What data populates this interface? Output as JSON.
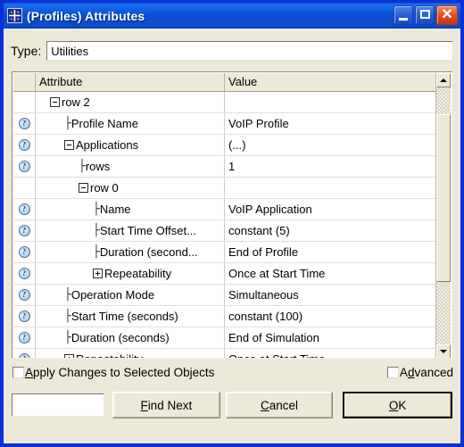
{
  "window": {
    "title": "(Profiles) Attributes",
    "icon": "sparkle-icon",
    "titlebar_color": "#0b52d4",
    "face_color": "#ece9d8",
    "buttons": {
      "minimize": "minimize-icon",
      "maximize": "maximize-icon",
      "close": "close-icon"
    }
  },
  "type_field": {
    "label": "Type:",
    "value": "Utilities",
    "placeholder": ""
  },
  "table": {
    "columns": [
      "",
      "Attribute",
      "Value"
    ],
    "rows": [
      {
        "icon": "",
        "indent": 1,
        "marker": "minus",
        "branch": "",
        "attribute": "row 2",
        "value": ""
      },
      {
        "icon": "help-icon",
        "indent": 2,
        "marker": "none",
        "branch": "├",
        "attribute": "Profile Name",
        "value": "VoIP Profile"
      },
      {
        "icon": "help-icon",
        "indent": 2,
        "marker": "minus",
        "branch": "",
        "attribute": "Applications",
        "value": "(...)"
      },
      {
        "icon": "help-icon",
        "indent": 3,
        "marker": "none",
        "branch": "├",
        "attribute": "rows",
        "value": "1"
      },
      {
        "icon": "",
        "indent": 3,
        "marker": "minus",
        "branch": "",
        "attribute": "row 0",
        "value": ""
      },
      {
        "icon": "help-icon",
        "indent": 4,
        "marker": "none",
        "branch": "├",
        "attribute": "Name",
        "value": "VoIP Application"
      },
      {
        "icon": "help-icon",
        "indent": 4,
        "marker": "none",
        "branch": "├",
        "attribute": "Start Time Offset...",
        "value": "constant (5)"
      },
      {
        "icon": "help-icon",
        "indent": 4,
        "marker": "none",
        "branch": "├",
        "attribute": "Duration (second...",
        "value": "End of Profile"
      },
      {
        "icon": "help-icon",
        "indent": 4,
        "marker": "plus",
        "branch": "",
        "attribute": "Repeatability",
        "value": "Once at Start Time"
      },
      {
        "icon": "help-icon",
        "indent": 2,
        "marker": "none",
        "branch": "├",
        "attribute": "Operation Mode",
        "value": "Simultaneous"
      },
      {
        "icon": "help-icon",
        "indent": 2,
        "marker": "none",
        "branch": "├",
        "attribute": "Start Time (seconds)",
        "value": "constant (100)"
      },
      {
        "icon": "help-icon",
        "indent": 2,
        "marker": "none",
        "branch": "├",
        "attribute": "Duration (seconds)",
        "value": "End of Simulation"
      },
      {
        "icon": "help-icon",
        "indent": 2,
        "marker": "plus",
        "branch": "",
        "attribute": "Repeatability",
        "value": "Once at Start Time"
      }
    ]
  },
  "scrollbar": {
    "up_arrow": "scroll-up-icon",
    "down_arrow": "scroll-down-icon",
    "thumb_position_percent": 30
  },
  "checkboxes": {
    "apply_changes": {
      "label_pre": "",
      "accel": "A",
      "label_post": "pply Changes to Selected Objects",
      "checked": false
    },
    "advanced": {
      "label_pre": "A",
      "accel": "d",
      "label_post": "vanced",
      "checked": false
    }
  },
  "footer": {
    "find_input_value": "",
    "find_input_placeholder": "",
    "find_next": {
      "label_pre": "",
      "accel": "F",
      "label_post": "ind Next"
    },
    "cancel": {
      "label_pre": "",
      "accel": "C",
      "label_post": "ancel"
    },
    "ok": {
      "label_pre": "",
      "accel": "O",
      "label_post": "K"
    }
  }
}
